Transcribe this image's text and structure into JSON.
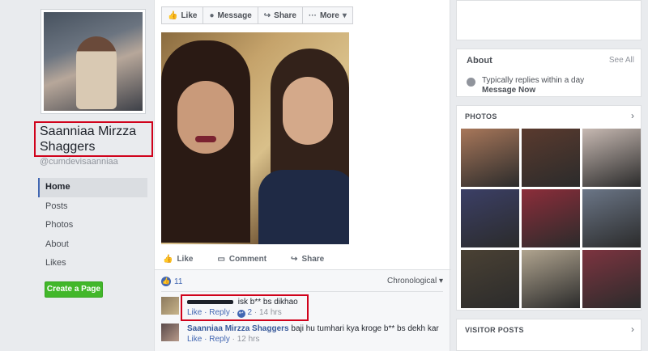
{
  "page": {
    "name": "Saanniaa Mirzza Shaggers",
    "handle": "@cumdevisaanniaa"
  },
  "left_nav": [
    "Home",
    "Posts",
    "Photos",
    "About",
    "Likes"
  ],
  "create_page_label": "Create a Page",
  "action_bar": {
    "like": "Like",
    "message": "Message",
    "share": "Share",
    "more": "More"
  },
  "post_actions": {
    "like": "Like",
    "comment": "Comment",
    "share": "Share"
  },
  "reactions_count": "11",
  "sort_label": "Chronological",
  "comments": [
    {
      "author_redacted": true,
      "text": "isk b** bs dikhao",
      "like": "Like",
      "reply": "Reply",
      "reply_count": "2",
      "time": "14 hrs"
    },
    {
      "author": "Saanniaa Mirzza Shaggers",
      "text": "baji hu tumhari kya kroge b** bs dekh kar",
      "like": "Like",
      "reply": "Reply",
      "time": "12 hrs"
    }
  ],
  "about": {
    "title": "About",
    "see_all": "See All",
    "response": "Typically replies within a day",
    "message_now": "Message Now"
  },
  "photos": {
    "title": "PHOTOS",
    "thumb_colors": [
      "#a8775a",
      "#5a3a2e",
      "#c7b9b2",
      "#3b3f66",
      "#8c2d3a",
      "#6b7687",
      "#4a4134",
      "#b0a48f",
      "#7d3440"
    ]
  },
  "visitor_posts": {
    "title": "VISITOR POSTS"
  },
  "colors": {
    "highlight_box": "#d0021b",
    "link_blue": "#365899",
    "create_green": "#42b72a"
  }
}
